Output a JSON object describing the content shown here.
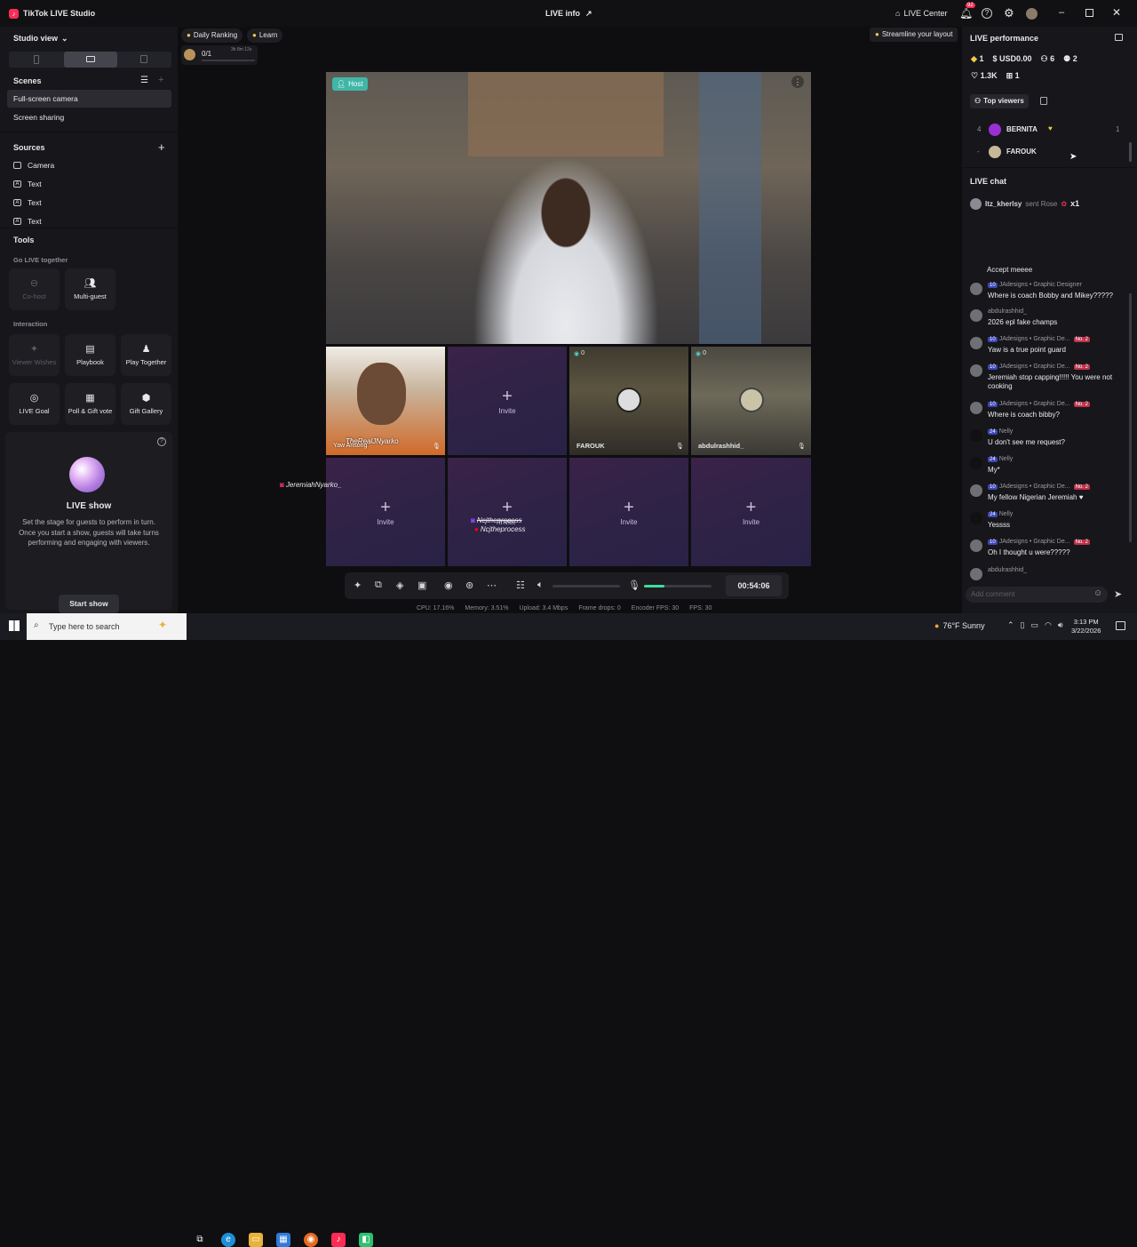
{
  "app": {
    "title": "TikTok LIVE Studio",
    "center_title": "LIVE info",
    "live_center": "LIVE Center",
    "notif_count": "92"
  },
  "left": {
    "studio_view": "Studio view",
    "scenes_title": "Scenes",
    "scenes": [
      "Full-screen camera",
      "Screen sharing"
    ],
    "sources_title": "Sources",
    "sources": [
      "Camera",
      "Text",
      "Text",
      "Text"
    ],
    "tools_title": "Tools",
    "go_live_together": "Go LIVE together",
    "cohost": "Co-host",
    "multiguest": "Multi-guest",
    "interaction": "Interaction",
    "viewer_wishes": "Viewer Wishes",
    "playbook": "Playbook",
    "play_together": "Play Together",
    "live_goal": "LIVE Goal",
    "poll_gift": "Poll & Gift vote",
    "gift_gallery": "Gift Gallery",
    "show_title": "LIVE show",
    "show_desc": "Set the stage for guests to perform in turn. Once you start a show, guests will take turns performing and engaging with viewers.",
    "start_show": "Start show"
  },
  "stage": {
    "daily_ranking": "Daily Ranking",
    "learn": "Learn",
    "goal_count": "0/1",
    "goal_time": "3h 8m 12s",
    "streamline": "Streamline your layout",
    "host_badge": "Host",
    "guest1_overlay": "TheRealJNyarko",
    "guest1_name": "Yaw Ansong",
    "invite": "Invite",
    "farouk_count": "0",
    "farouk_name": "FAROUK",
    "abdul_count": "0",
    "abdul_name": "abdulrashhid_",
    "jeremiah_overlay": "JeremiahNyarko_",
    "ncj_overlay1": "Ncjtheprocess",
    "ncj_overlay2": "Ncjtheprocess",
    "timer": "00:54:06",
    "stats": {
      "cpu": "CPU: 17.16%",
      "memory": "Memory: 3.51%",
      "upload": "Upload: 3.4 Mbps",
      "drops": "Frame drops: 0",
      "encoder": "Encoder FPS: 30",
      "fps": "FPS: 30"
    },
    "mic_level": 0.3
  },
  "right": {
    "perf_title": "LIVE performance",
    "stat_diamonds": "1",
    "stat_usd": "USD0.00",
    "stat_viewers": "6",
    "stat_new": "2",
    "stat_likes": "1.3K",
    "stat_gifts": "1",
    "top_viewers": "Top viewers",
    "viewer1_rank": "4",
    "viewer1_name": "BERNITA",
    "viewer1_count": "1",
    "viewer2_rank": "-",
    "viewer2_name": "FAROUK",
    "chat_title": "LIVE chat",
    "gift_user": "Itz_kherlsy",
    "gift_text": "sent Rose",
    "gift_count": "x1",
    "accept": "Accept meeee",
    "messages": [
      {
        "badge": "10",
        "who": "JAdesigns • Graphic Designer",
        "no": "",
        "text": "Where is coach Bobby and Mikey?????"
      },
      {
        "badge": "",
        "who": "abdulrashhid_",
        "no": "",
        "text": "2026 epl fake champs"
      },
      {
        "badge": "10",
        "who": "JAdesigns • Graphic De...",
        "no": "No. 2",
        "text": "Yaw is a true point guard"
      },
      {
        "badge": "10",
        "who": "JAdesigns • Graphic De...",
        "no": "No. 2",
        "text": "Jeremiah stop capping!!!!! You were not cooking"
      },
      {
        "badge": "10",
        "who": "JAdesigns • Graphic De...",
        "no": "No. 2",
        "text": "Where is coach bibby?"
      },
      {
        "badge": "24",
        "who": "Nelly",
        "no": "",
        "text": "U don't see me request?"
      },
      {
        "badge": "24",
        "who": "Nelly",
        "no": "",
        "text": "My*"
      },
      {
        "badge": "10",
        "who": "JAdesigns • Graphic De...",
        "no": "No. 2",
        "text": "My fellow Nigerian Jeremiah ♥"
      },
      {
        "badge": "24",
        "who": "Nelly",
        "no": "",
        "text": "Yessss"
      },
      {
        "badge": "10",
        "who": "JAdesigns • Graphic De...",
        "no": "No. 2",
        "text": "Oh I thought u were?????"
      },
      {
        "badge": "",
        "who": "abdulrashhid_",
        "no": "",
        "text": ""
      }
    ],
    "add_comment": "Add comment"
  },
  "taskbar": {
    "search": "Type here to search",
    "weather": "76°F  Sunny",
    "time": "3:13 PM",
    "date": "3/22/2026"
  }
}
